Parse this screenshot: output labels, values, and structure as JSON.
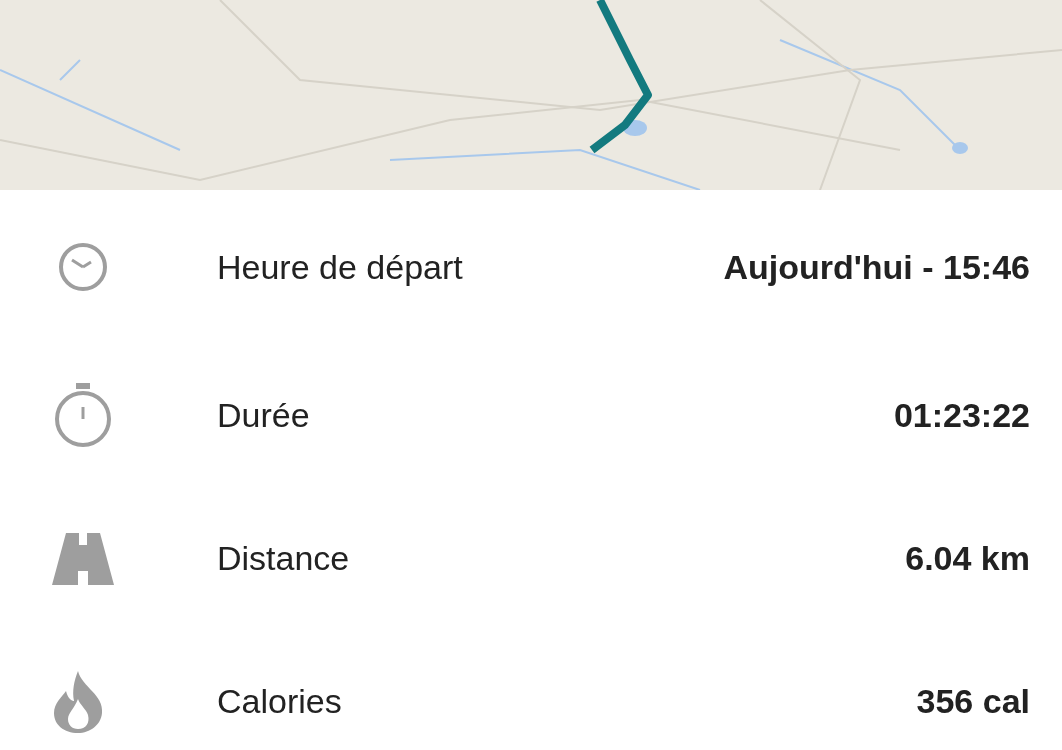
{
  "stats": [
    {
      "kind": "clock",
      "label": "Heure de départ",
      "value": "Aujourd'hui - 15:46"
    },
    {
      "kind": "stopwatch",
      "label": "Durée",
      "value": "01:23:22"
    },
    {
      "kind": "road",
      "label": "Distance",
      "value": "6.04 km"
    },
    {
      "kind": "flame",
      "label": "Calories",
      "value": "356 cal"
    }
  ]
}
